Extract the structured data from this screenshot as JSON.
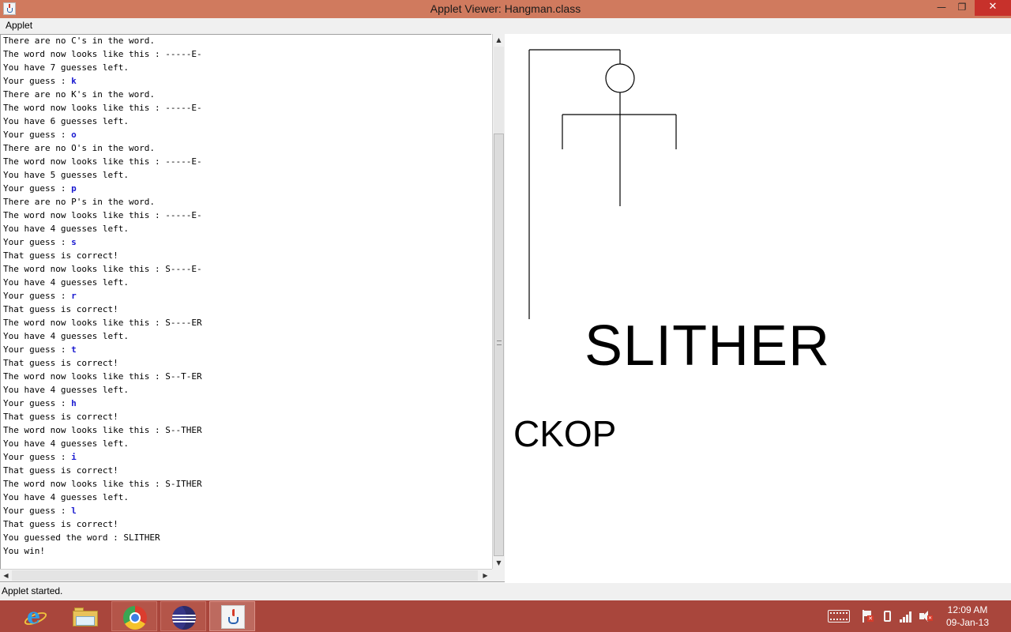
{
  "window": {
    "title": "Applet Viewer: Hangman.class",
    "minimize_label": "—",
    "maximize_label": "❐",
    "close_label": "✕"
  },
  "menu": {
    "items": [
      {
        "label": "Applet"
      }
    ]
  },
  "console": {
    "lines": [
      {
        "text": "There are no C's in the word.",
        "input": ""
      },
      {
        "text": "The word now looks like this : -----E-",
        "input": ""
      },
      {
        "text": "You have 7 guesses left.",
        "input": ""
      },
      {
        "text": "Your guess : ",
        "input": "k"
      },
      {
        "text": "There are no K's in the word.",
        "input": ""
      },
      {
        "text": "The word now looks like this : -----E-",
        "input": ""
      },
      {
        "text": "You have 6 guesses left.",
        "input": ""
      },
      {
        "text": "Your guess : ",
        "input": "o"
      },
      {
        "text": "There are no O's in the word.",
        "input": ""
      },
      {
        "text": "The word now looks like this : -----E-",
        "input": ""
      },
      {
        "text": "You have 5 guesses left.",
        "input": ""
      },
      {
        "text": "Your guess : ",
        "input": "p"
      },
      {
        "text": "There are no P's in the word.",
        "input": ""
      },
      {
        "text": "The word now looks like this : -----E-",
        "input": ""
      },
      {
        "text": "You have 4 guesses left.",
        "input": ""
      },
      {
        "text": "Your guess : ",
        "input": "s"
      },
      {
        "text": "That guess is correct!",
        "input": ""
      },
      {
        "text": "The word now looks like this : S----E-",
        "input": ""
      },
      {
        "text": "You have 4 guesses left.",
        "input": ""
      },
      {
        "text": "Your guess : ",
        "input": "r"
      },
      {
        "text": "That guess is correct!",
        "input": ""
      },
      {
        "text": "The word now looks like this : S----ER",
        "input": ""
      },
      {
        "text": "You have 4 guesses left.",
        "input": ""
      },
      {
        "text": "Your guess : ",
        "input": "t"
      },
      {
        "text": "That guess is correct!",
        "input": ""
      },
      {
        "text": "The word now looks like this : S--T-ER",
        "input": ""
      },
      {
        "text": "You have 4 guesses left.",
        "input": ""
      },
      {
        "text": "Your guess : ",
        "input": "h"
      },
      {
        "text": "That guess is correct!",
        "input": ""
      },
      {
        "text": "The word now looks like this : S--THER",
        "input": ""
      },
      {
        "text": "You have 4 guesses left.",
        "input": ""
      },
      {
        "text": "Your guess : ",
        "input": "i"
      },
      {
        "text": "That guess is correct!",
        "input": ""
      },
      {
        "text": "The word now looks like this : S-ITHER",
        "input": ""
      },
      {
        "text": "You have 4 guesses left.",
        "input": ""
      },
      {
        "text": "Your guess : ",
        "input": "l"
      },
      {
        "text": "That guess is correct!",
        "input": ""
      },
      {
        "text": "You guessed the word : SLITHER",
        "input": ""
      },
      {
        "text": "You win!",
        "input": ""
      }
    ]
  },
  "game": {
    "word": "SLITHER",
    "wrong_letters": "CKOP"
  },
  "status": {
    "text": "Applet started."
  },
  "taskbar": {
    "apps": [
      {
        "name": "internet-explorer"
      },
      {
        "name": "file-explorer"
      },
      {
        "name": "chrome"
      },
      {
        "name": "eclipse"
      },
      {
        "name": "java-applet-viewer"
      }
    ],
    "clock": {
      "time": "12:09 AM",
      "date": "09-Jan-13"
    }
  },
  "colors": {
    "title_bar": "#d07a5e",
    "taskbar": "#a9463c",
    "console_input": "#1a1ad0",
    "close_button": "#c7312b"
  }
}
